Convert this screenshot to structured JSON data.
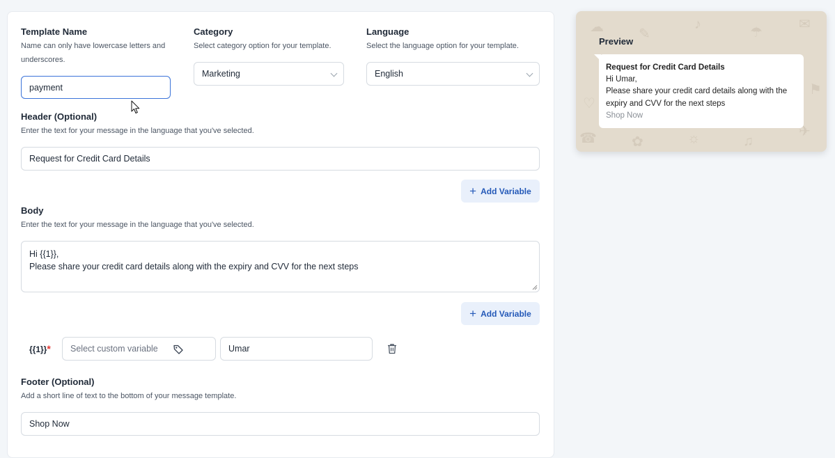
{
  "template_name": {
    "label": "Template Name",
    "hint": "Name can only have lowercase letters and underscores.",
    "value": "payment"
  },
  "category": {
    "label": "Category",
    "hint": "Select category option for your template.",
    "value": "Marketing"
  },
  "language": {
    "label": "Language",
    "hint": "Select the language option for your template.",
    "value": "English"
  },
  "header": {
    "label": "Header (Optional)",
    "hint": "Enter the text for your message in the language that you've selected.",
    "value": "Request for Credit Card Details",
    "add_variable": "Add Variable"
  },
  "body": {
    "label": "Body",
    "hint": "Enter the text for your message in the language that you've selected.",
    "value": "Hi {{1}},\nPlease share your credit card details along with the expiry and CVV for the next steps",
    "add_variable": "Add Variable"
  },
  "variable": {
    "token": "{{1}}",
    "required_mark": "*",
    "custom_placeholder": "Select custom variable",
    "sample_value": "Umar"
  },
  "footer": {
    "label": "Footer (Optional)",
    "hint": "Add a short line of text to the bottom of your message template.",
    "value": "Shop Now"
  },
  "preview": {
    "title": "Preview",
    "header": "Request for Credit Card Details",
    "greeting": "Hi Umar,",
    "body": "Please share your credit card details along with the expiry and CVV for the next steps",
    "footer": "Shop Now"
  },
  "colors": {
    "accent": "#3b73d9",
    "button_bg": "#e9f0fb",
    "button_text": "#2459b8",
    "required": "#e53935",
    "preview_bg": "#e3dbcd"
  }
}
